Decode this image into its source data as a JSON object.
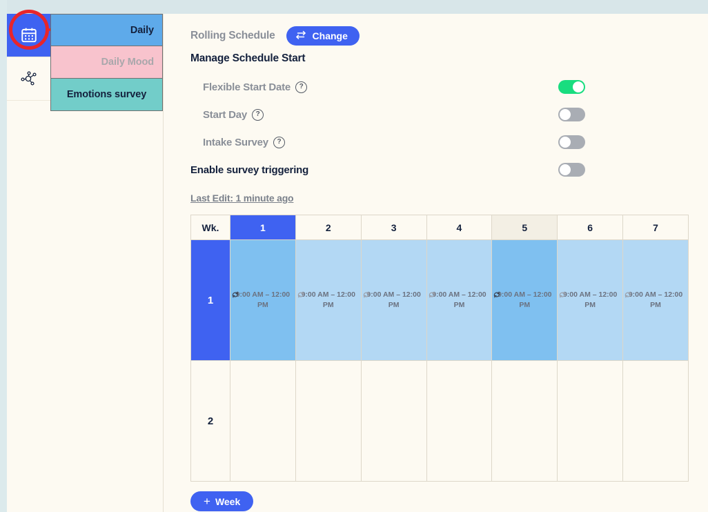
{
  "colors": {
    "accent_blue": "#3f62f1",
    "toggle_on_green": "#19dd7f",
    "toggle_off_gray": "#a9adb4",
    "page_bg": "#fdfaf2",
    "top_band": "#d8e6e9",
    "tab_daily_bg": "#5eaaea",
    "tab_dailymood_bg": "#f8c3cd",
    "tab_emotions_bg": "#72cdc9",
    "cell_filled": "#b3d8f4",
    "cell_filled_hover": "#7fc0f0",
    "annotation_red": "#e9252a"
  },
  "rail": {
    "items": [
      {
        "icon": "calendar-icon",
        "active": true
      },
      {
        "icon": "network-graph-icon",
        "active": false
      }
    ]
  },
  "tabs": [
    {
      "label": "Daily",
      "style": "daily"
    },
    {
      "label": "Daily Mood",
      "style": "dailymood"
    },
    {
      "label": "Emotions survey",
      "style": "emotions"
    }
  ],
  "header": {
    "schedule_type_label": "Rolling Schedule",
    "change_button_label": "Change",
    "change_button_icon": "swap-arrows-icon",
    "section_title": "Manage Schedule Start"
  },
  "options": [
    {
      "label": "Flexible Start Date",
      "help": "?",
      "toggle_on": true,
      "indent": true,
      "bold": false
    },
    {
      "label": "Start Day",
      "help": "?",
      "toggle_on": false,
      "indent": true,
      "bold": false
    },
    {
      "label": "Intake Survey",
      "help": "?",
      "toggle_on": false,
      "indent": true,
      "bold": false
    },
    {
      "label": "Enable survey triggering",
      "help": null,
      "toggle_on": false,
      "indent": false,
      "bold": true
    }
  ],
  "last_edit": "Last Edit: 1 minute ago",
  "grid": {
    "week_col_header": "Wk.",
    "day_headers": [
      {
        "label": "1",
        "selected": true,
        "hover": false
      },
      {
        "label": "2",
        "selected": false,
        "hover": false
      },
      {
        "label": "3",
        "selected": false,
        "hover": false
      },
      {
        "label": "4",
        "selected": false,
        "hover": false
      },
      {
        "label": "5",
        "selected": false,
        "hover": true
      },
      {
        "label": "6",
        "selected": false,
        "hover": false
      },
      {
        "label": "7",
        "selected": false,
        "hover": false
      }
    ],
    "slot_text": "9:00 AM – 12:00 PM",
    "slot_icon": "repeat-icon",
    "rows": [
      {
        "week": "1",
        "week_selected": true,
        "cells": [
          {
            "filled": true,
            "hover": true,
            "slot": "9:00 AM – 12:00 PM"
          },
          {
            "filled": true,
            "hover": false,
            "slot": "9:00 AM – 12:00 PM"
          },
          {
            "filled": true,
            "hover": false,
            "slot": "9:00 AM – 12:00 PM"
          },
          {
            "filled": true,
            "hover": false,
            "slot": "9:00 AM – 12:00 PM"
          },
          {
            "filled": true,
            "hover": true,
            "slot": "9:00 AM – 12:00 PM"
          },
          {
            "filled": true,
            "hover": false,
            "slot": "9:00 AM – 12:00 PM"
          },
          {
            "filled": true,
            "hover": false,
            "slot": "9:00 AM – 12:00 PM"
          }
        ]
      },
      {
        "week": "2",
        "week_selected": false,
        "cells": [
          {
            "filled": false,
            "hover": false,
            "slot": ""
          },
          {
            "filled": false,
            "hover": false,
            "slot": ""
          },
          {
            "filled": false,
            "hover": false,
            "slot": ""
          },
          {
            "filled": false,
            "hover": false,
            "slot": ""
          },
          {
            "filled": false,
            "hover": false,
            "slot": ""
          },
          {
            "filled": false,
            "hover": false,
            "slot": ""
          },
          {
            "filled": false,
            "hover": false,
            "slot": ""
          }
        ]
      }
    ],
    "add_week_label": "Week",
    "add_week_plus": "+"
  }
}
